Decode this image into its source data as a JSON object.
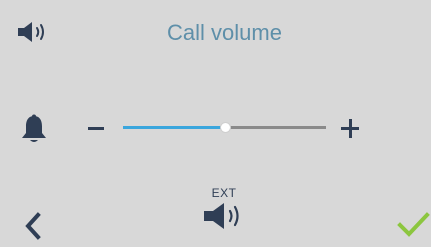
{
  "header": {
    "title": "Call volume",
    "icon": "speaker-icon"
  },
  "volume": {
    "icon": "bell-icon",
    "decrease_icon": "minus-icon",
    "increase_icon": "plus-icon",
    "level": 0.5
  },
  "output": {
    "label": "EXT",
    "icon": "speaker-icon"
  },
  "footer": {
    "back_icon": "chevron-left-icon",
    "confirm_icon": "checkmark-icon"
  },
  "colors": {
    "background": "#d8d8d8",
    "title": "#5e8fa9",
    "icon": "#2f3e55",
    "slider_fill": "#3aa6dd",
    "slider_track": "#8a8a8a",
    "confirm": "#8cc63f"
  }
}
